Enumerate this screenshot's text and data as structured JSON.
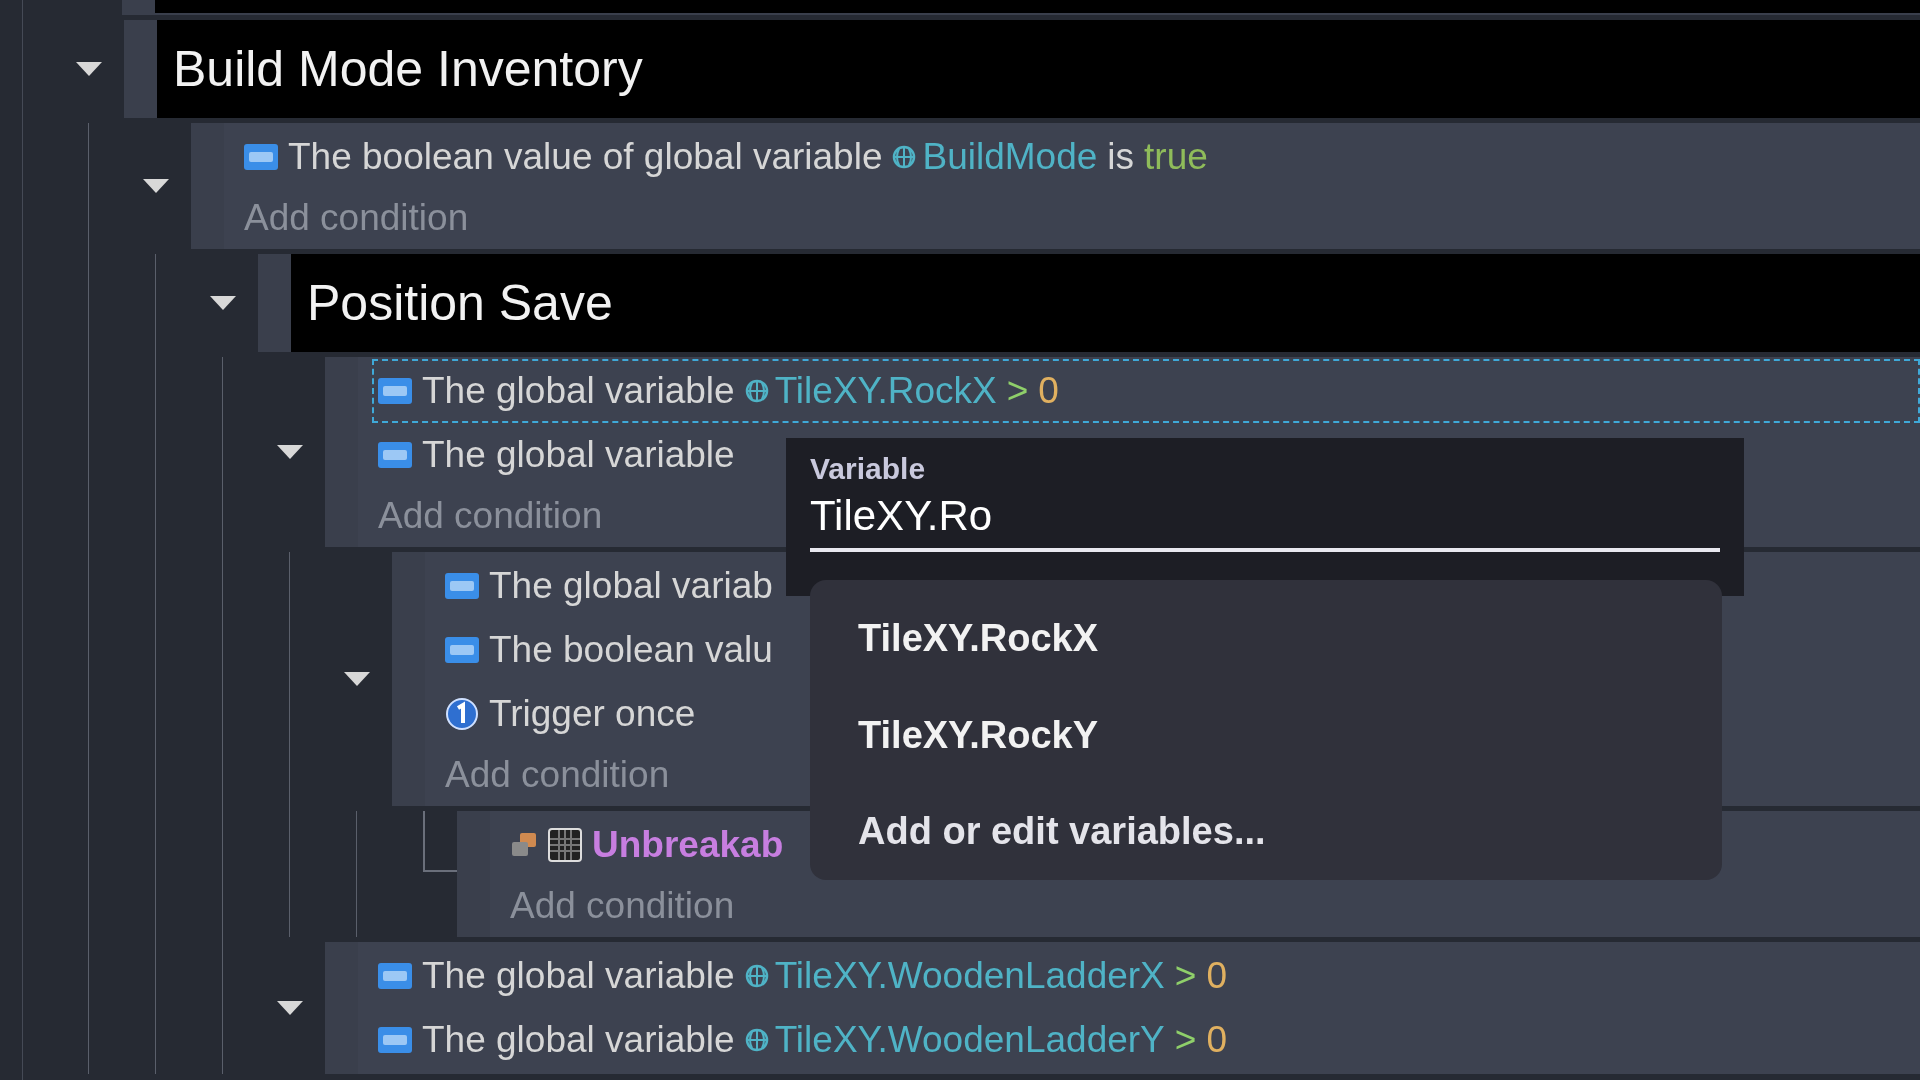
{
  "events": [
    {
      "kind": "group",
      "title": "Build Mode Inventory",
      "expanded": true,
      "children": [
        {
          "kind": "standard",
          "expanded": true,
          "add_condition": "Add condition",
          "conditions": [
            {
              "kind": "variable",
              "selected": false,
              "parts": [
                {
                  "kind": "text",
                  "text": "The boolean value of global variable"
                },
                {
                  "kind": "var",
                  "text": "BuildMode"
                },
                {
                  "kind": "text",
                  "text": "is"
                },
                {
                  "kind": "bool",
                  "text": "true"
                }
              ]
            }
          ],
          "children": [
            {
              "kind": "group",
              "title": "Position Save",
              "expanded": true,
              "children": [
                {
                  "kind": "standard",
                  "expanded": true,
                  "add_condition": "Add condition",
                  "conditions": [
                    {
                      "kind": "variable",
                      "selected": true,
                      "parts": [
                        {
                          "kind": "text",
                          "text": "The global variable"
                        },
                        {
                          "kind": "var",
                          "text": "TileXY.RockX"
                        },
                        {
                          "kind": "op",
                          "text": ">"
                        },
                        {
                          "kind": "num",
                          "text": "0"
                        }
                      ]
                    },
                    {
                      "kind": "variable",
                      "selected": false,
                      "parts": [
                        {
                          "kind": "text",
                          "text": "The global variable"
                        }
                      ]
                    }
                  ],
                  "children": [
                    {
                      "kind": "standard",
                      "expanded": true,
                      "add_condition": "Add condition",
                      "conditions": [
                        {
                          "kind": "variable",
                          "selected": false,
                          "parts": [
                            {
                              "kind": "text",
                              "text": "The global variab"
                            }
                          ]
                        },
                        {
                          "kind": "variable",
                          "selected": false,
                          "parts": [
                            {
                              "kind": "text",
                              "text": "The boolean valu"
                            }
                          ]
                        },
                        {
                          "kind": "trigger",
                          "selected": false,
                          "parts": [
                            {
                              "kind": "text",
                              "text": "Trigger once"
                            }
                          ]
                        }
                      ],
                      "children": [
                        {
                          "kind": "standard",
                          "add_condition": "Add condition",
                          "conditions": [
                            {
                              "kind": "collision",
                              "selected": false,
                              "parts": [
                                {
                                  "kind": "object",
                                  "text": "Unbreakab"
                                }
                              ]
                            }
                          ]
                        }
                      ]
                    }
                  ]
                },
                {
                  "kind": "standard",
                  "expanded": true,
                  "conditions": [
                    {
                      "kind": "variable",
                      "selected": false,
                      "parts": [
                        {
                          "kind": "text",
                          "text": "The global variable"
                        },
                        {
                          "kind": "var",
                          "text": "TileXY.WoodenLadderX"
                        },
                        {
                          "kind": "op",
                          "text": ">"
                        },
                        {
                          "kind": "num",
                          "text": "0"
                        }
                      ]
                    },
                    {
                      "kind": "variable",
                      "selected": false,
                      "parts": [
                        {
                          "kind": "text",
                          "text": "The global variable"
                        },
                        {
                          "kind": "var",
                          "text": "TileXY.WoodenLadderY"
                        },
                        {
                          "kind": "op",
                          "text": ">"
                        },
                        {
                          "kind": "num",
                          "text": "0"
                        }
                      ]
                    }
                  ]
                }
              ]
            }
          ]
        }
      ]
    }
  ],
  "variable_popup": {
    "label": "Variable",
    "value": "TileXY.Ro",
    "options": [
      {
        "kind": "variable",
        "label": "TileXY.RockX"
      },
      {
        "kind": "variable",
        "label": "TileXY.RockY"
      },
      {
        "kind": "action",
        "label": "Add or edit variables..."
      }
    ]
  }
}
